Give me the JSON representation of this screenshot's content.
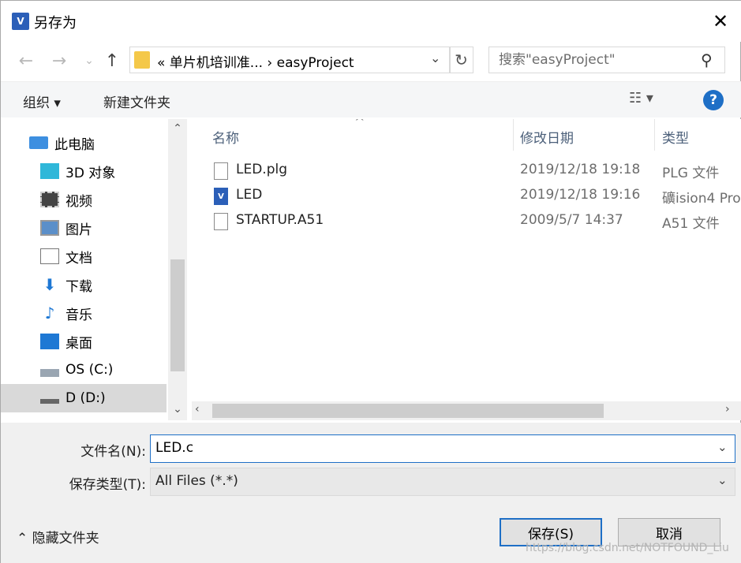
{
  "window": {
    "title": "另存为",
    "close_glyph": "✕"
  },
  "nav": {
    "back_glyph": "←",
    "forward_glyph": "→",
    "recent_glyph": "⌄",
    "up_glyph": "↑",
    "address": "«  单片机培训准...  ›   easyProject",
    "address_dropdown_glyph": "⌄",
    "refresh_glyph": "↻",
    "search_placeholder": "搜索\"easyProject\"",
    "search_glyph": "⚲"
  },
  "toolbar": {
    "organize": "组织 ▾",
    "new_folder": "新建文件夹",
    "view_glyph": "☷ ▾",
    "help_glyph": "?"
  },
  "sidebar": {
    "items": [
      {
        "label": "此电脑",
        "icon": "computer-icon"
      },
      {
        "label": "3D 对象",
        "icon": "3d-objects-icon"
      },
      {
        "label": "视频",
        "icon": "video-icon"
      },
      {
        "label": "图片",
        "icon": "pictures-icon"
      },
      {
        "label": "文档",
        "icon": "documents-icon"
      },
      {
        "label": "下载",
        "icon": "download-icon"
      },
      {
        "label": "音乐",
        "icon": "music-icon"
      },
      {
        "label": "桌面",
        "icon": "desktop-icon"
      },
      {
        "label": "OS (C:)",
        "icon": "drive-c-icon"
      },
      {
        "label": "D (D:)",
        "icon": "drive-d-icon"
      }
    ],
    "scroll_up_glyph": "⌃",
    "scroll_down_glyph": "⌄"
  },
  "filelist": {
    "sort_glyph": "^",
    "columns": {
      "name": "名称",
      "date": "修改日期",
      "type": "类型"
    },
    "rows": [
      {
        "name": "LED.plg",
        "date": "2019/12/18 19:18",
        "type": "PLG 文件",
        "icon": "document-icon"
      },
      {
        "name": "LED",
        "date": "2019/12/18 19:16",
        "type": "礦ision4 Pro",
        "icon": "uvision-icon"
      },
      {
        "name": "STARTUP.A51",
        "date": "2009/5/7 14:37",
        "type": "A51 文件",
        "icon": "document-icon"
      }
    ],
    "hscroll_left_glyph": "‹",
    "hscroll_right_glyph": "›"
  },
  "form": {
    "filename_label": "文件名(N):",
    "filename_value": "LED.c",
    "filetype_label": "保存类型(T):",
    "filetype_value": "All Files (*.*)",
    "dropdown_glyph": "⌄",
    "hide_folders": "⌃  隐藏文件夹",
    "save_label": "保存(S)",
    "cancel_label": "取消",
    "watermark": "https://blog.csdn.net/NOTFOUND_Liu"
  }
}
